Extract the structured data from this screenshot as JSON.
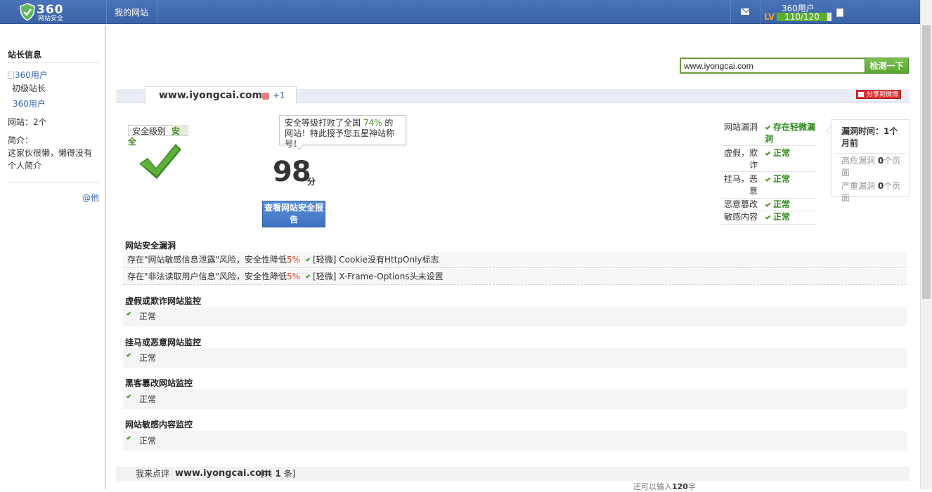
{
  "header": {
    "logo_text": "360",
    "logo_sub": "网站安全",
    "nav_mysite": "我的网站",
    "user_name": "360用户",
    "level_prefix": "LV",
    "level_progress": "110/120",
    "level_fraction": 0.917
  },
  "sidebar": {
    "title": "站长信息",
    "avatar_alt": "360用户",
    "level": "初级站长",
    "user": "360用户",
    "sites": "网站：2个",
    "intro_label": "简介：",
    "intro": "这家伙很懒，懒得没有个人简介",
    "at_link": "@他"
  },
  "search": {
    "value": "www.iyongcai.com",
    "button": "检测一下"
  },
  "site": {
    "name": "www.iyongcai.com",
    "like": "+1",
    "share": "分享到微博"
  },
  "summary": {
    "level_label": "安全级别",
    "level_value_1": "安",
    "level_value_2": "全",
    "tooltip_1": "安全等级打败了全国",
    "tooltip_pct": "74%",
    "tooltip_2": "的网站！特此授予您五星神站称号！",
    "score": "98",
    "score_unit": "分",
    "report_button": "查看网站安全报告"
  },
  "status": [
    {
      "label": "网站漏洞",
      "value": "存在轻微漏洞"
    },
    {
      "label": "虚假，欺诈",
      "value": "正常"
    },
    {
      "label": "挂马，恶意",
      "value": "正常"
    },
    {
      "label": "恶意篡改",
      "value": "正常"
    },
    {
      "label": "敏感内容",
      "value": "正常"
    }
  ],
  "vuln_time": {
    "title": "漏洞时间：1个月前",
    "high_label": "高危漏洞",
    "high_count": "0",
    "high_unit": "个页面",
    "severe_label": "严重漏洞",
    "severe_count": "0",
    "severe_unit": "个页面"
  },
  "sections": {
    "vuln": {
      "title": "网站安全漏洞",
      "rows": [
        {
          "risk": "存在\"网站敏感信息泄露\"风险，安全性降低",
          "pct": "5%",
          "detail": "[轻微] Cookie没有HttpOnly标志"
        },
        {
          "risk": "存在\"非法读取用户信息\"风险，安全性降低",
          "pct": "5%",
          "detail": "[轻微] X-Frame-Options头未设置"
        }
      ]
    },
    "fraud": {
      "title": "虚假或欺诈网站监控",
      "status": "正常"
    },
    "trojan": {
      "title": "挂马或恶意网站监控",
      "status": "正常"
    },
    "tamper": {
      "title": "黑客篡改网站监控",
      "status": "正常"
    },
    "sensitive": {
      "title": "网站敏感内容监控",
      "status": "正常"
    }
  },
  "comment": {
    "label": "我来点评",
    "site": "www.iyongcai.com",
    "count_prefix": "[共",
    "count": "1",
    "count_suffix": "条]",
    "remain_prefix": "还可以输入",
    "remain_count": "120",
    "remain_suffix": "字"
  }
}
